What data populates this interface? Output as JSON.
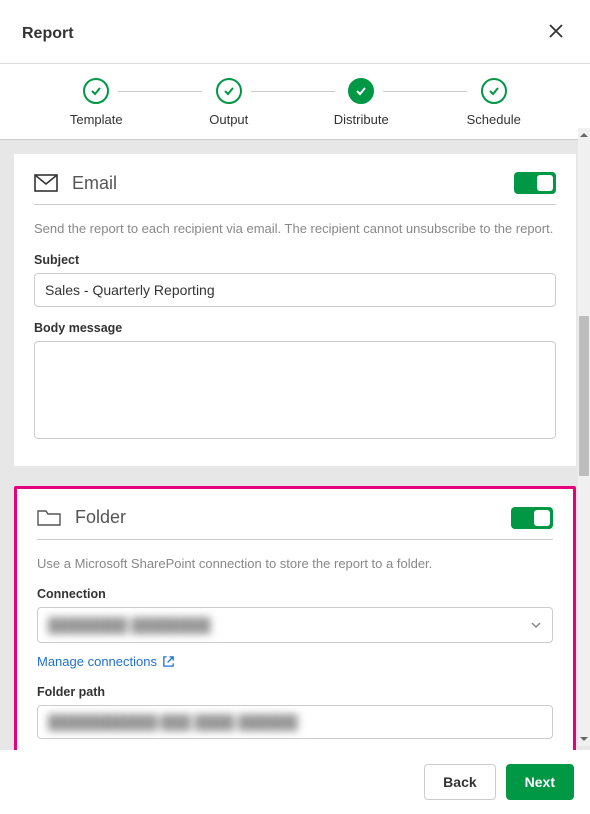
{
  "header": {
    "title": "Report"
  },
  "stepper": {
    "steps": [
      {
        "label": "Template",
        "state": "done-outline"
      },
      {
        "label": "Output",
        "state": "done-outline"
      },
      {
        "label": "Distribute",
        "state": "active-filled"
      },
      {
        "label": "Schedule",
        "state": "done-outline"
      }
    ]
  },
  "email": {
    "title": "Email",
    "toggle": true,
    "description": "Send the report to each recipient via email. The recipient cannot unsubscribe to the report.",
    "subject_label": "Subject",
    "subject_value": "Sales - Quarterly Reporting",
    "body_label": "Body message",
    "body_value": ""
  },
  "folder": {
    "title": "Folder",
    "toggle": true,
    "description": "Use a Microsoft SharePoint connection to store the report to a folder.",
    "connection_label": "Connection",
    "connection_value": "████████ ████████",
    "manage_link": "Manage connections",
    "path_label": "Folder path",
    "path_value": "███████████/███ ████ ██████"
  },
  "footer": {
    "back": "Back",
    "next": "Next"
  }
}
